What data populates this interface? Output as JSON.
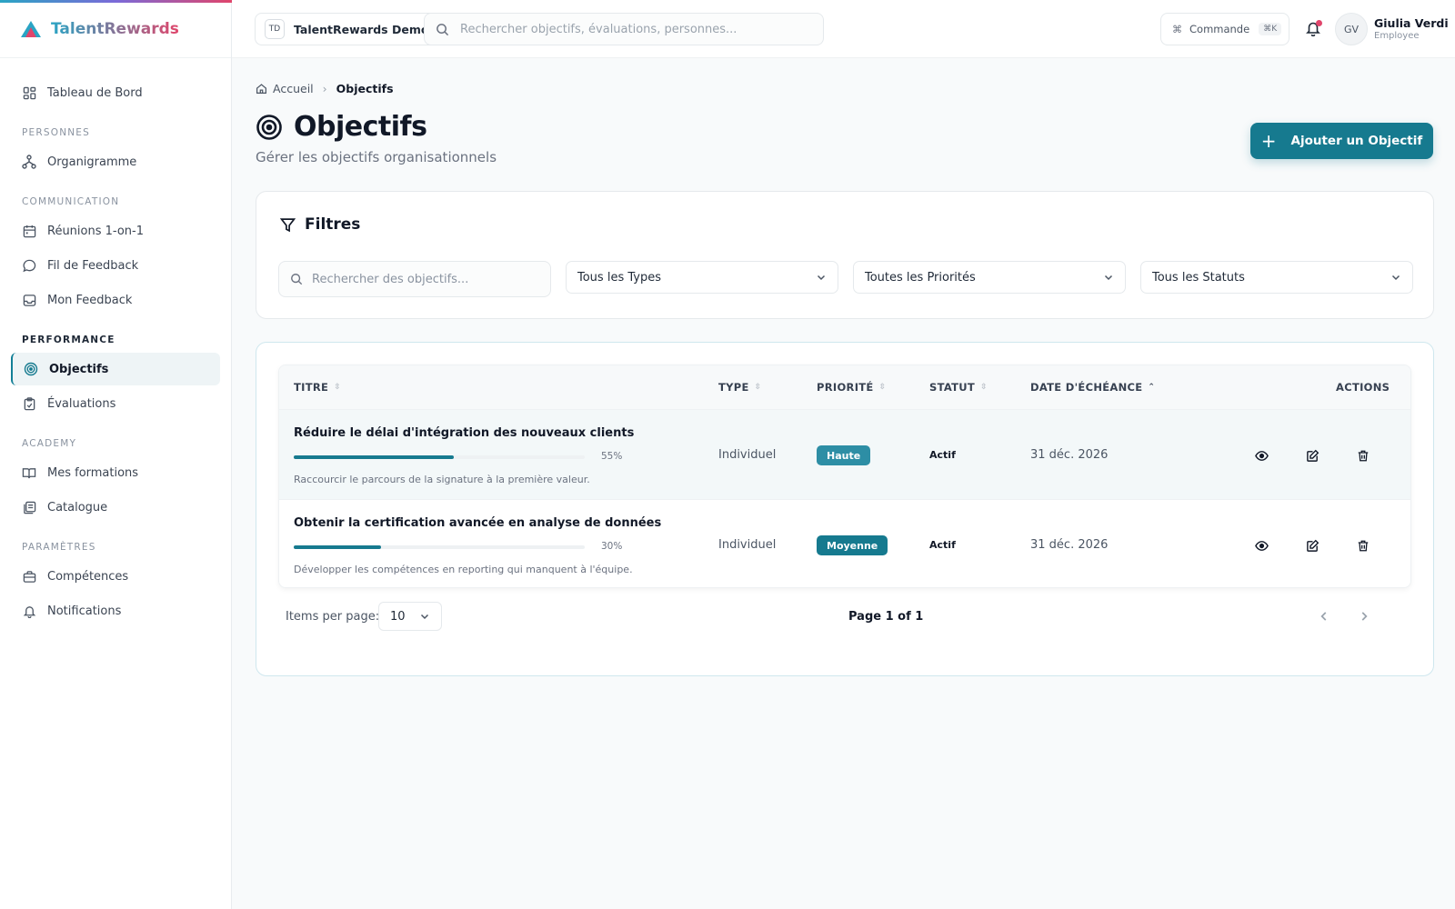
{
  "brand": {
    "name": "TalentRewards"
  },
  "sidebar": {
    "dashboard": "Tableau de Bord",
    "sections": [
      {
        "title": "PERSONNES",
        "items": [
          "Organigramme"
        ]
      },
      {
        "title": "COMMUNICATION",
        "items": [
          "Réunions 1-on-1",
          "Fil de Feedback",
          "Mon Feedback"
        ]
      },
      {
        "title": "PERFORMANCE",
        "items": [
          "Objectifs",
          "Évaluations"
        ]
      },
      {
        "title": "ACADEMY",
        "items": [
          "Mes formations",
          "Catalogue"
        ]
      },
      {
        "title": "PARAMÈTRES",
        "items": [
          "Compétences",
          "Notifications"
        ]
      }
    ]
  },
  "topbar": {
    "org_badge": "TD",
    "org_name": "TalentRewards Demo",
    "search_placeholder": "Rechercher objectifs, évaluations, personnes...",
    "command_label": "Commande",
    "command_kbd": "⌘K",
    "user_initials": "GV",
    "user_name": "Giulia Verdi",
    "user_role": "Employee"
  },
  "breadcrumb": {
    "home": "Accueil",
    "current": "Objectifs"
  },
  "page": {
    "title": "Objectifs",
    "subtitle": "Gérer les objectifs organisationnels",
    "add_button": "Ajouter un Objectif"
  },
  "filters": {
    "title": "Filtres",
    "search_placeholder": "Rechercher des objectifs...",
    "type_select": "Tous les Types",
    "priority_select": "Toutes les Priorités",
    "status_select": "Tous les Statuts"
  },
  "table": {
    "columns": {
      "title": "TITRE",
      "type": "TYPE",
      "priority": "PRIORITÉ",
      "status": "STATUT",
      "due": "DATE D'ÉCHÉANCE",
      "actions": "ACTIONS"
    },
    "rows": [
      {
        "title": "Réduire le délai d'intégration des nouveaux clients",
        "progress": 55,
        "progress_label": "55%",
        "description": "Raccourcir le parcours de la signature à la première valeur.",
        "type": "Individuel",
        "priority": "Haute",
        "status": "Actif",
        "due": "31 déc. 2026"
      },
      {
        "title": "Obtenir la certification avancée en analyse de données",
        "progress": 30,
        "progress_label": "30%",
        "description": "Développer les compétences en reporting qui manquent à l'équipe.",
        "type": "Individuel",
        "priority": "Moyenne",
        "status": "Actif",
        "due": "31 déc. 2026"
      }
    ]
  },
  "pagination": {
    "items_label": "Items per page:",
    "items_value": "10",
    "page_info": "Page 1 of 1"
  },
  "colors": {
    "accent": "#167a8f",
    "badge_high": "#2d8ea5",
    "notification_dot": "#e0456b"
  }
}
